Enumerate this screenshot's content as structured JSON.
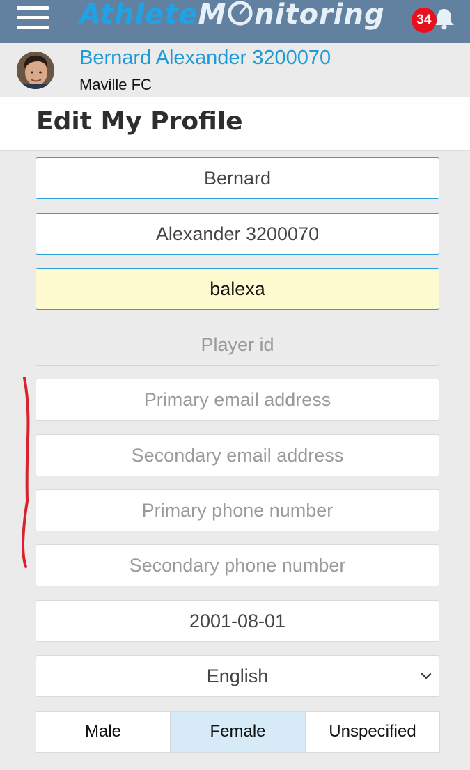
{
  "topbar": {
    "brand_part1": "Athlete",
    "brand_part2": "M",
    "brand_part3": "nitoring",
    "notification_count": "34",
    "menu_icon": "hamburger-menu-icon",
    "bell_icon": "bell-icon",
    "colors": {
      "bar": "#62809f",
      "brand_blue": "#1fa3e6",
      "badge": "#e8101c"
    }
  },
  "profile": {
    "name": "Bernard Alexander 3200070",
    "team": "Maville FC"
  },
  "page": {
    "title": "Edit My Profile"
  },
  "form": {
    "first_name": {
      "value": "Bernard",
      "placeholder": ""
    },
    "last_name": {
      "value": "Alexander 3200070",
      "placeholder": ""
    },
    "username": {
      "value": "balexa",
      "placeholder": ""
    },
    "player_id": {
      "value": "",
      "placeholder": "Player id"
    },
    "primary_email": {
      "value": "",
      "placeholder": "Primary email address"
    },
    "secondary_email": {
      "value": "",
      "placeholder": "Secondary email address"
    },
    "primary_phone": {
      "value": "",
      "placeholder": "Primary phone number"
    },
    "secondary_phone": {
      "value": "",
      "placeholder": "Secondary phone number"
    },
    "birth_date": {
      "value": "2001-08-01"
    },
    "language": {
      "selected": "English"
    },
    "gender": {
      "options": [
        "Male",
        "Female",
        "Unspecified"
      ],
      "selected": "Female"
    }
  },
  "annotation": {
    "color": "#d9232a"
  }
}
